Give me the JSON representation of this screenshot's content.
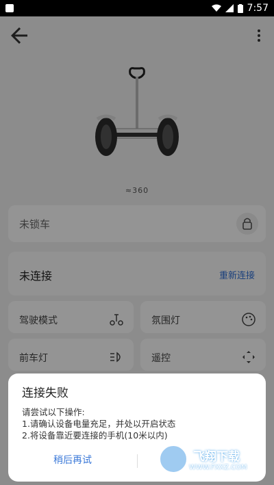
{
  "statusbar": {
    "time": "7:57"
  },
  "appbar": {
    "back_icon": "back-arrow-icon",
    "more_icon": "more-vert-icon"
  },
  "device": {
    "brand": "≈360"
  },
  "lock": {
    "label": "未锁车",
    "icon": "lock-icon"
  },
  "connection": {
    "label": "未连接",
    "action": "重新连接"
  },
  "features": [
    {
      "label": "驾驶模式",
      "icon": "scooter-icon"
    },
    {
      "label": "氛围灯",
      "icon": "palette-icon"
    },
    {
      "label": "前车灯",
      "icon": "headlight-icon"
    },
    {
      "label": "遥控",
      "icon": "remote-control-icon"
    }
  ],
  "dialog": {
    "title": "连接失败",
    "line1": "请尝试以下操作:",
    "line2": "1.请确认设备电量充足，并处以开启状态",
    "line3": "2.将设备靠近要连接的手机(10米以内)",
    "retry": "稍后再试",
    "other": ""
  },
  "watermark": {
    "main": "飞翔下载",
    "sub": "WWW.FXXZ.COM"
  }
}
